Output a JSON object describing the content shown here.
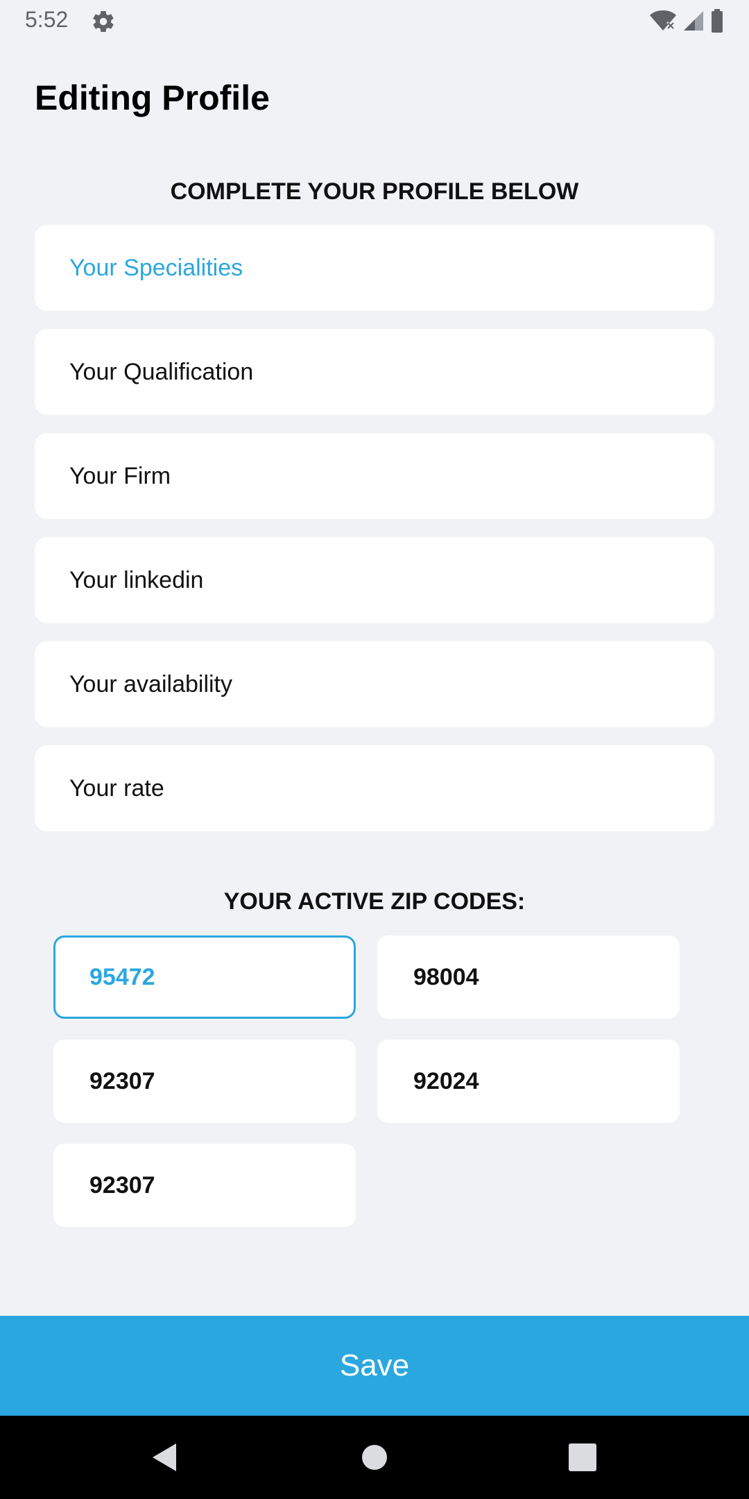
{
  "status_bar": {
    "time": "5:52",
    "icons": [
      "gear-icon",
      "wifi-off-icon",
      "signal-icon",
      "battery-icon"
    ]
  },
  "page": {
    "title": "Editing Profile"
  },
  "profile_section": {
    "heading": "COMPLETE YOUR PROFILE BELOW",
    "fields": [
      {
        "label": "Your Specialities",
        "active": true
      },
      {
        "label": "Your Qualification",
        "active": false
      },
      {
        "label": "Your Firm",
        "active": false
      },
      {
        "label": "Your linkedin",
        "active": false
      },
      {
        "label": "Your availability",
        "active": false
      },
      {
        "label": "Your rate",
        "active": false
      }
    ]
  },
  "zip_section": {
    "heading": "YOUR ACTIVE ZIP CODES:",
    "codes": [
      {
        "value": "95472",
        "selected": true
      },
      {
        "value": "98004",
        "selected": false
      },
      {
        "value": "92307",
        "selected": false
      },
      {
        "value": "92024",
        "selected": false
      },
      {
        "value": "92307",
        "selected": false
      }
    ]
  },
  "actions": {
    "save_label": "Save"
  },
  "colors": {
    "accent": "#2aa7df",
    "background": "#f1f2f6",
    "card": "#ffffff"
  }
}
